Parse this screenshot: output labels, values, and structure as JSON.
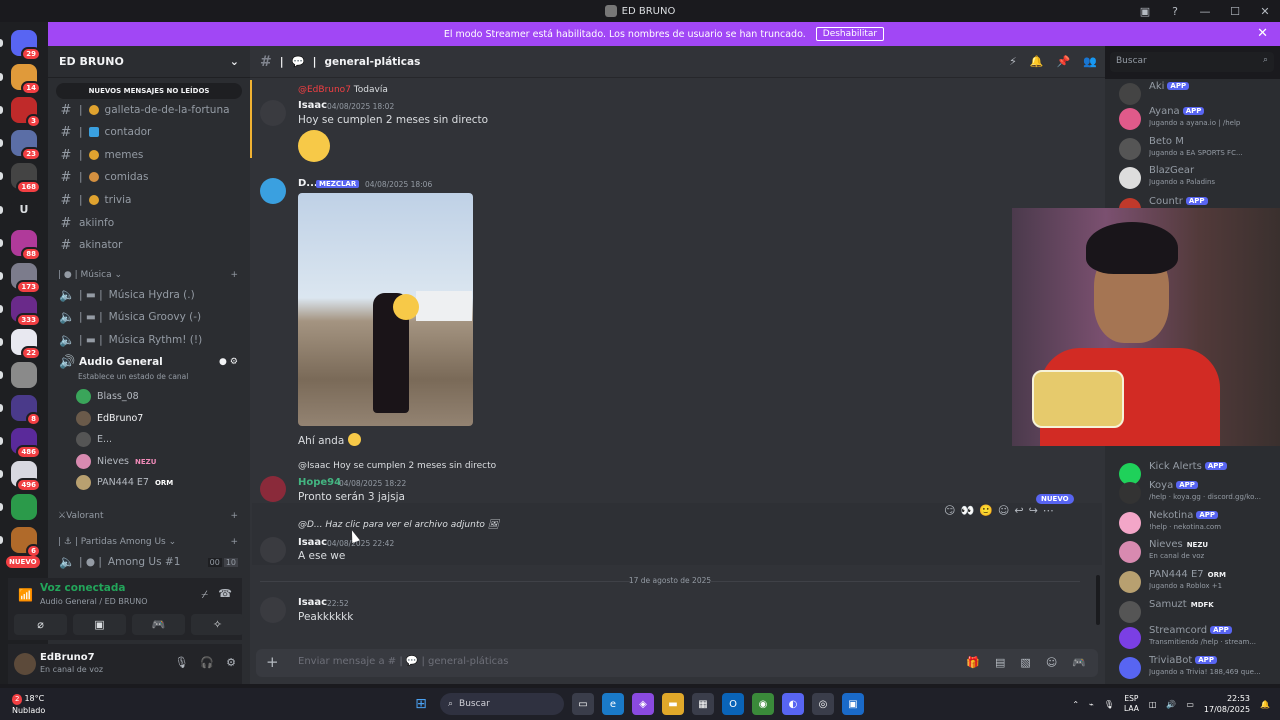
{
  "window": {
    "title": "ED BRUNO"
  },
  "banner": {
    "text": "El modo Streamer está habilitado. Los nombres de usuario se han truncado.",
    "button": "Deshabilitar"
  },
  "servers": [
    {
      "badge": "29",
      "color": "#5865f2"
    },
    {
      "badge": "14",
      "color": "#e09a3a"
    },
    {
      "badge": "3",
      "color": "#c02a2a"
    },
    {
      "badge": "23",
      "color": "#5b6ea6"
    },
    {
      "badge": "168",
      "color": "#444"
    },
    {
      "badge": "",
      "letter": "U",
      "color": "#1e1f22"
    },
    {
      "badge": "88",
      "color": "#b03a9a"
    },
    {
      "badge": "173",
      "color": "#7c7c8c"
    },
    {
      "badge": "333",
      "color": "#6a2a8a"
    },
    {
      "badge": "22",
      "color": "#e8e8f0"
    },
    {
      "badge": "",
      "color": "#8a8a8a"
    },
    {
      "badge": "8",
      "color": "#4a3a8a"
    },
    {
      "badge": "486",
      "color": "#5a2a9a"
    },
    {
      "badge": "496",
      "color": "#d8d8e0"
    },
    {
      "badge": "",
      "color": "#2b9a4a"
    },
    {
      "badge": "6",
      "color": "#b06a2a"
    }
  ],
  "nuevo_servers": "NUEVO",
  "channel_sidebar": {
    "server_name": "ED BRUNO",
    "unread_pill": "NUEVOS MENSAJES NO LEÍDOS",
    "text_channels": [
      "galleta-de-de-la-fortuna",
      "contador",
      "memes",
      "comidas",
      "trivia",
      "akiinfo",
      "akinator"
    ],
    "music_category": "Música",
    "voice_channels": [
      "Música Hydra (.)",
      "Música Groovy (-)",
      "Música Rythm! (!)"
    ],
    "audio_general": "Audio General",
    "audio_status": "Establece un estado de canal",
    "voice_users": [
      {
        "name": "Blass_08",
        "tag": ""
      },
      {
        "name": "EdBruno7",
        "tag": ""
      },
      {
        "name": "E...",
        "tag": ""
      },
      {
        "name": "Nieves",
        "tag": "NEZU"
      },
      {
        "name": "PAN444 E7",
        "tag": "ORM"
      }
    ],
    "valorant_category": "Valorant",
    "among_category": "Partidas Among Us",
    "among_channel": "Among Us #1",
    "among_counts": [
      "00",
      "10"
    ]
  },
  "voice_panel": {
    "status": "Voz conectada",
    "location": "Audio General / ED BRUNO"
  },
  "user": {
    "name": "EdBruno7",
    "status": "En canal de voz"
  },
  "chat": {
    "channel_name": "general-pláticas",
    "messages": [
      {
        "reply": "Todavía",
        "author": "Isaac",
        "time": "04/08/2025 18:02",
        "text": "Hoy se cumplen 2 meses sin directo"
      },
      {
        "author": "D...",
        "tag": "MEZCLAR",
        "time": "04/08/2025 18:06",
        "caption": "Ahí anda"
      },
      {
        "reply": "@Isaac Hoy se cumplen 2 meses sin directo",
        "author": "Hope94",
        "time": "04/08/2025 18:22",
        "text": "Pronto serán 3 jajsja"
      },
      {
        "reply": "@D... Haz clic para ver el archivo adjunto",
        "author": "Isaac",
        "time": "04/08/2025 22:42",
        "text": "A ese we"
      },
      {
        "author": "Isaac",
        "time": "22:52",
        "text": "Peakkkkkk"
      }
    ],
    "date_separator": "17 de agosto de 2025",
    "composer_placeholder": "Enviar mensaje a # | 💬 | general-pláticas",
    "nuevo": "NUEVO"
  },
  "search": {
    "placeholder": "Buscar"
  },
  "members": [
    {
      "name": "Aki",
      "app": true,
      "sub": "",
      "color": "#444"
    },
    {
      "name": "Ayana",
      "app": true,
      "sub": "Jugando a ayana.io | /help",
      "color": "#e05a8a"
    },
    {
      "name": "Beto M",
      "app": false,
      "sub": "Jugando a EA SPORTS FC...",
      "color": "#555"
    },
    {
      "name": "BlazGear",
      "app": false,
      "sub": "Jugando a Paladins",
      "color": "#ddd"
    },
    {
      "name": "Countr",
      "app": true,
      "sub": "",
      "color": "#c0392b"
    },
    {
      "name": "Kick Alerts",
      "app": true,
      "sub": "",
      "color": "#1fd15a"
    },
    {
      "name": "Koya",
      "app": true,
      "sub": "/help · koya.gg · discord.gg/ko...",
      "color": "#333"
    },
    {
      "name": "Nekotina",
      "app": true,
      "sub": "!help · nekotina.com",
      "color": "#f3a6c8"
    },
    {
      "name": "Nieves",
      "app": false,
      "tag": "NEZU",
      "sub": "En canal de voz",
      "color": "#d88ab0"
    },
    {
      "name": "PAN444 E7",
      "app": false,
      "tag": "ORM",
      "sub": "Jugando a Roblox +1",
      "color": "#b8a070"
    },
    {
      "name": "Samuzt",
      "app": false,
      "tag": "MDFK",
      "sub": "",
      "color": "#555"
    },
    {
      "name": "Streamcord",
      "app": true,
      "sub": "Transmitiendo /help · stream...",
      "color": "#7b3fe4"
    },
    {
      "name": "TriviaBot",
      "app": true,
      "sub": "Jugando a Trivia! 188,469 que...",
      "color": "#5865f2"
    }
  ],
  "app_label": "APP",
  "taskbar": {
    "temp": "18°C",
    "weather": "Nublado",
    "search": "Buscar",
    "lang1": "ESP",
    "lang2": "LAA",
    "time": "22:53",
    "date": "17/08/2025",
    "notif": "2"
  }
}
